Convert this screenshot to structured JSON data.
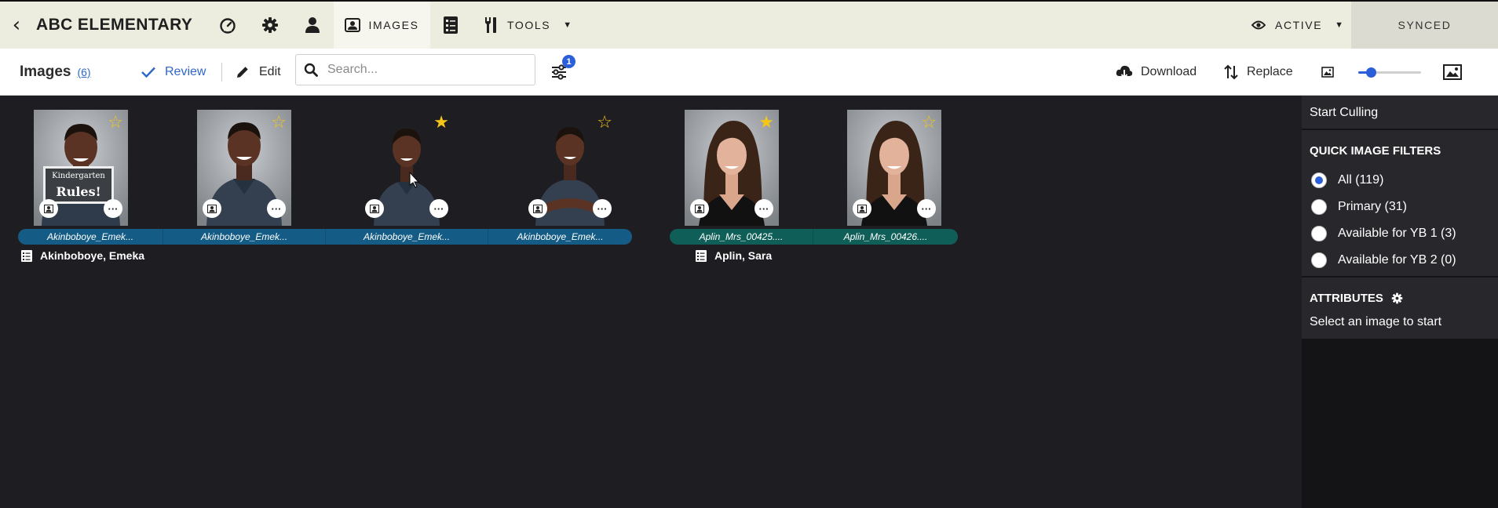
{
  "topnav": {
    "app_title": "ABC ELEMENTARY",
    "images_label": "IMAGES",
    "tools_label": "TOOLS",
    "active_label": "ACTIVE",
    "sync_status": "SYNCED"
  },
  "toolbar": {
    "title": "Images",
    "count": "(6)",
    "review_label": "Review",
    "edit_label": "Edit",
    "search_placeholder": "Search...",
    "filter_badge": "1",
    "download_label": "Download",
    "replace_label": "Replace",
    "zoom_fraction": 0.2
  },
  "gallery": {
    "groups": [
      {
        "person": "Akinboboye, Emeka",
        "band_color": "#145c85",
        "images": [
          {
            "caption": "Akinboboye_Emek...",
            "starred": false,
            "sign_top": "Kindergarten",
            "sign_bottom": "Rules!"
          },
          {
            "caption": "Akinboboye_Emek...",
            "starred": false
          },
          {
            "caption": "Akinboboye_Emek...",
            "starred": true
          },
          {
            "caption": "Akinboboye_Emek...",
            "starred": false
          }
        ]
      },
      {
        "person": "Aplin, Sara",
        "band_color": "#0f5f58",
        "images": [
          {
            "caption": "Aplin_Mrs_00425....",
            "starred": true
          },
          {
            "caption": "Aplin_Mrs_00426....",
            "starred": false
          }
        ]
      }
    ]
  },
  "panel": {
    "culling_label": "Start Culling",
    "filters_heading": "QUICK IMAGE FILTERS",
    "filters": [
      {
        "label": "All (119)",
        "selected": true
      },
      {
        "label": "Primary (31)",
        "selected": false
      },
      {
        "label": "Available for YB 1 (3)",
        "selected": false
      },
      {
        "label": "Available for YB 2 (0)",
        "selected": false
      }
    ],
    "attributes_heading": "ATTRIBUTES",
    "attributes_hint": "Select an image to start"
  }
}
